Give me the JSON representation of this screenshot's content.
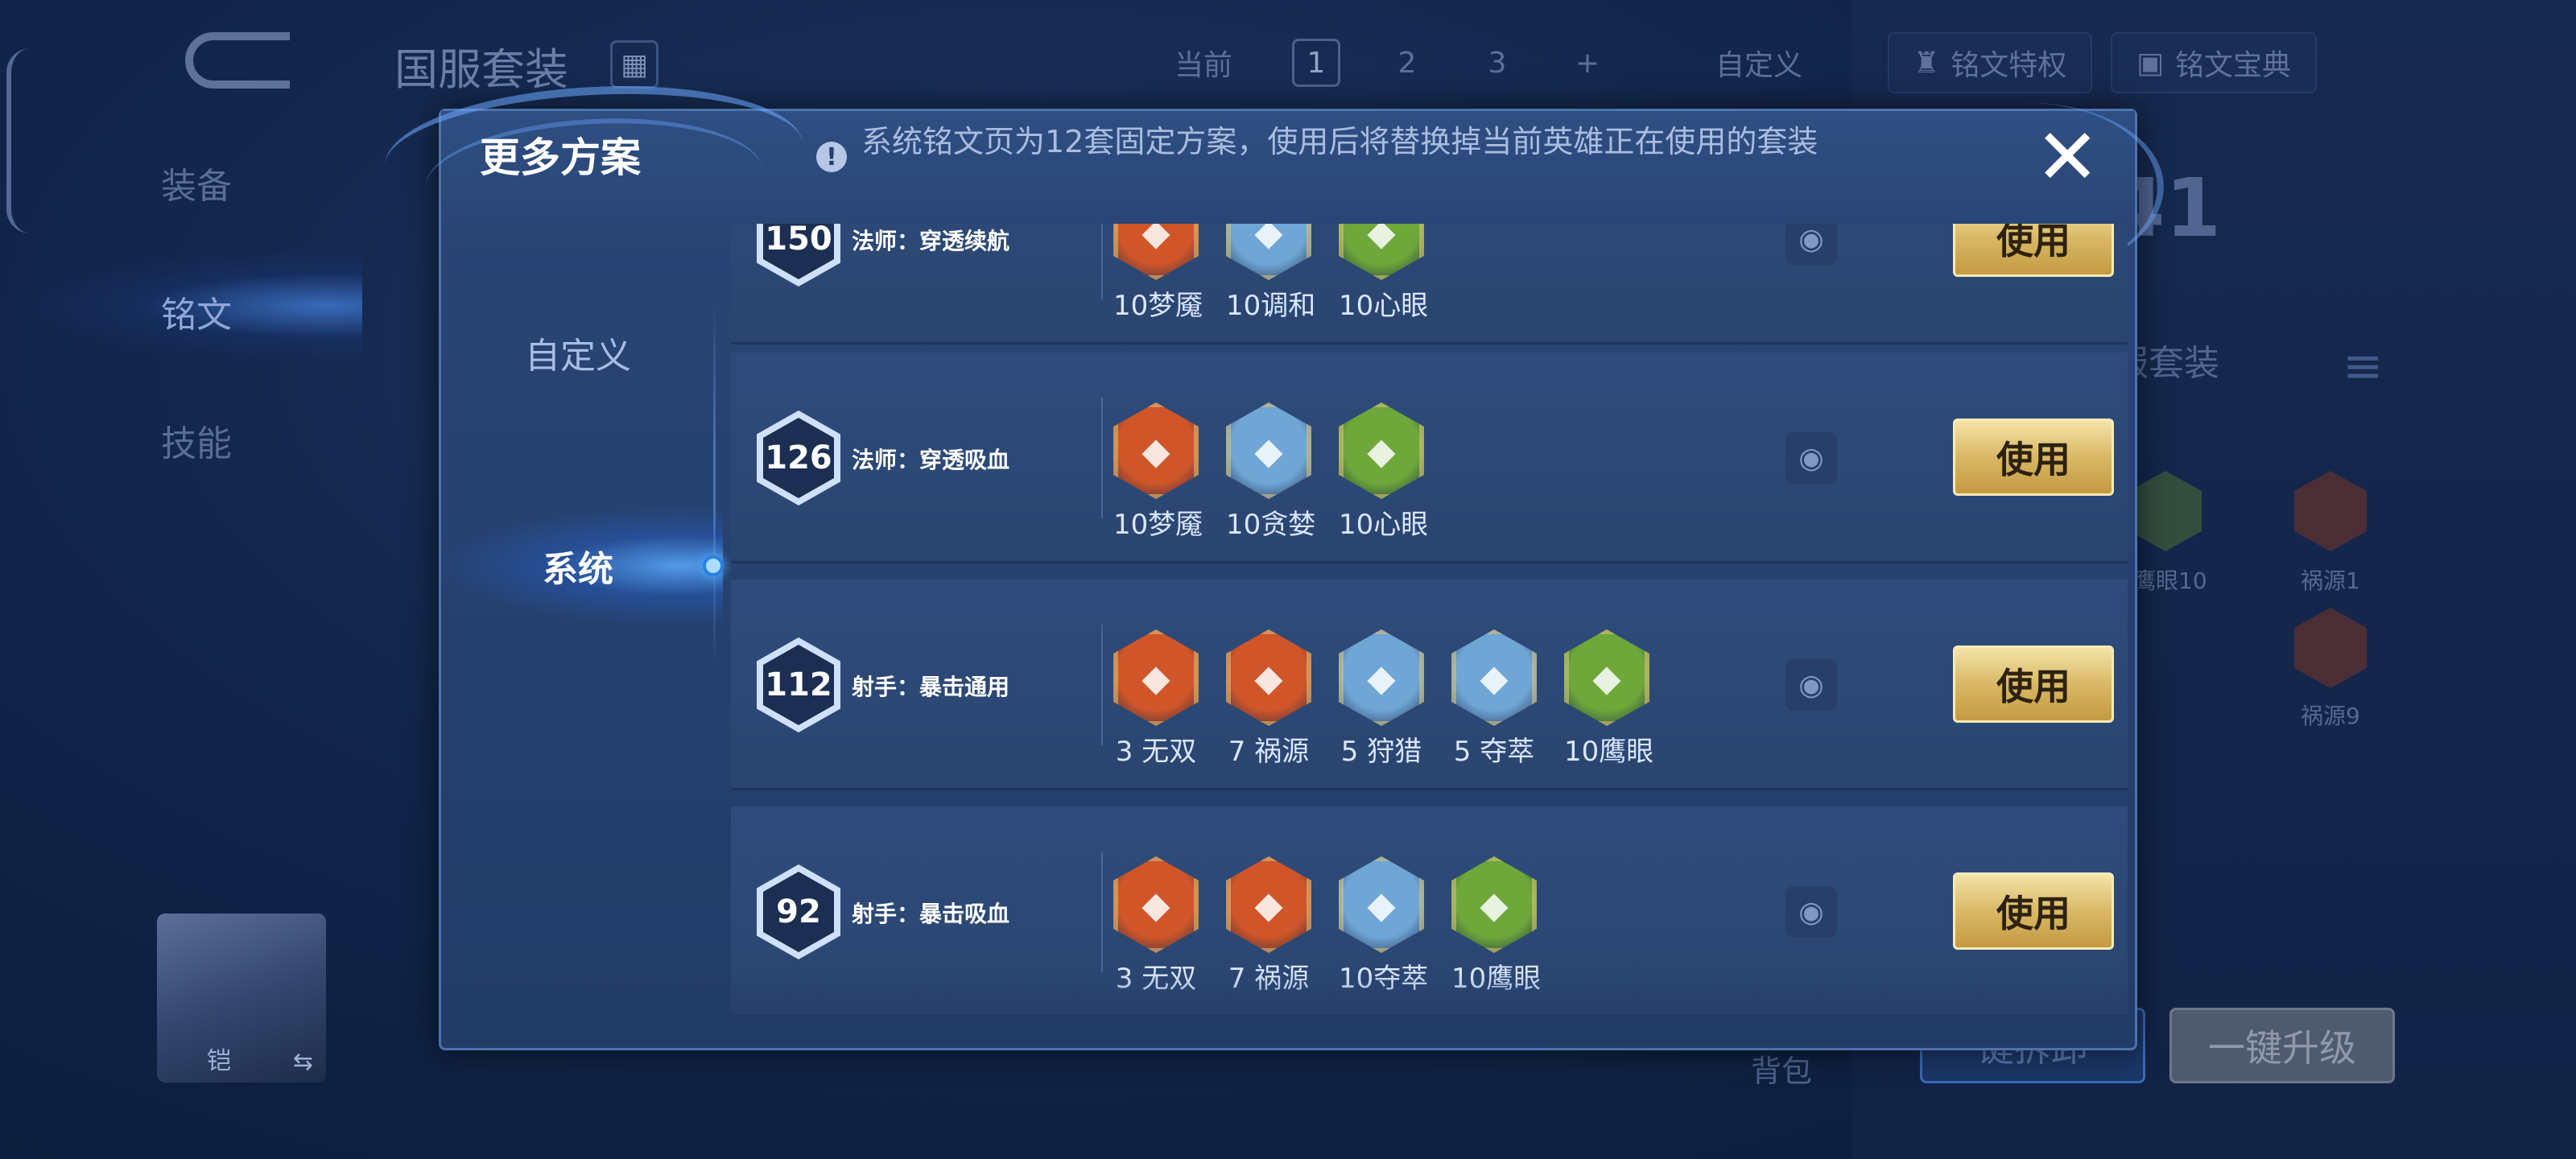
{
  "background": {
    "title": "国服套装",
    "nav": [
      "装备",
      "铭文",
      "技能"
    ],
    "toolbar": {
      "current_label": "当前",
      "pages": [
        "1",
        "2",
        "3",
        "+"
      ],
      "custom_label": "自定义"
    },
    "buttons": {
      "rune_privilege": "铭文特权",
      "rune_codex": "铭文宝典"
    },
    "rune_count": "41",
    "set_label": "服套装",
    "side_runes": [
      {
        "label": "鹰眼10",
        "color": "#5b8a3a"
      },
      {
        "label": "祸源1",
        "color": "#9a3b2c"
      },
      {
        "label": "祸源9",
        "color": "#9a3b2c"
      }
    ],
    "hero_name": "铠",
    "swap_icon": "⇆",
    "bag_label": "背包",
    "bottom_buttons": [
      "键拆卸",
      "一键升级"
    ]
  },
  "dialog": {
    "title": "更多方案",
    "notice": "系统铭文页为12套固定方案，使用后将替换掉当前英雄正在使用的套装",
    "close_icon": "✕",
    "tabs": [
      "自定义",
      "系统"
    ],
    "active_tab": "系统",
    "use_label": "使用",
    "plans": [
      {
        "level": "150",
        "name": "法师：穿透续航",
        "runes": [
          {
            "label": "10梦魇",
            "icon": "dream-rune-icon",
            "color": "#d0562a"
          },
          {
            "label": "10调和",
            "icon": "harmony-rune-icon",
            "color": "#6fa6d6"
          },
          {
            "label": "10心眼",
            "icon": "mind-eye-rune-icon",
            "color": "#6ea83a"
          }
        ]
      },
      {
        "level": "126",
        "name": "法师：穿透吸血",
        "runes": [
          {
            "label": "10梦魇",
            "icon": "dream-rune-icon",
            "color": "#d0562a"
          },
          {
            "label": "10贪婪",
            "icon": "greed-rune-icon",
            "color": "#6fa6d6"
          },
          {
            "label": "10心眼",
            "icon": "mind-eye-rune-icon",
            "color": "#6ea83a"
          }
        ]
      },
      {
        "level": "112",
        "name": "射手：暴击通用",
        "runes": [
          {
            "label": "3 无双",
            "icon": "peerless-rune-icon",
            "color": "#d0562a"
          },
          {
            "label": "7 祸源",
            "icon": "calamity-rune-icon",
            "color": "#d0562a"
          },
          {
            "label": "5 狩猎",
            "icon": "hunt-rune-icon",
            "color": "#6fa6d6"
          },
          {
            "label": "5 夺萃",
            "icon": "plunder-rune-icon",
            "color": "#6fa6d6"
          },
          {
            "label": "10鹰眼",
            "icon": "hawk-eye-rune-icon",
            "color": "#6ea83a"
          }
        ]
      },
      {
        "level": "92",
        "name": "射手：暴击吸血",
        "runes": [
          {
            "label": "3 无双",
            "icon": "peerless-rune-icon",
            "color": "#d0562a"
          },
          {
            "label": "7 祸源",
            "icon": "calamity-rune-icon",
            "color": "#d0562a"
          },
          {
            "label": "10夺萃",
            "icon": "plunder-rune-icon",
            "color": "#6fa6d6"
          },
          {
            "label": "10鹰眼",
            "icon": "hawk-eye-rune-icon",
            "color": "#6ea83a"
          }
        ]
      }
    ]
  }
}
